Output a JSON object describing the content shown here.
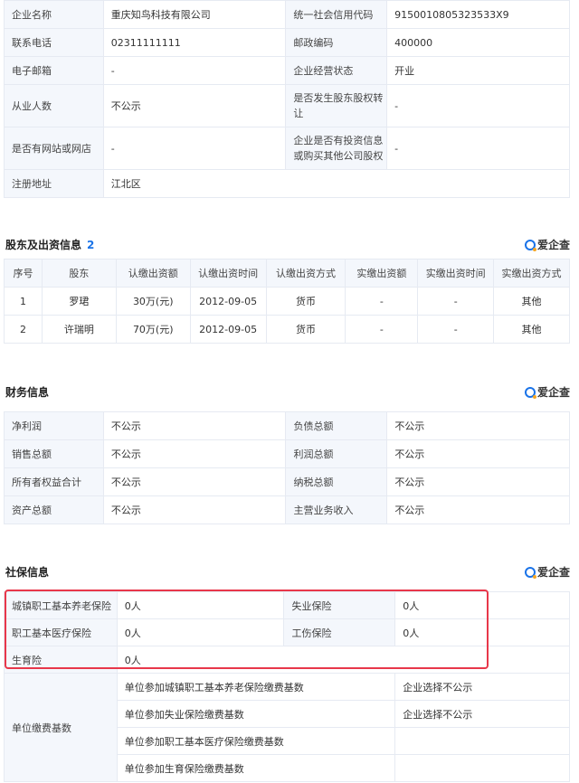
{
  "basic": {
    "rows": [
      {
        "l1": "企业名称",
        "v1": "重庆知鸟科技有限公司",
        "l2": "统一社会信用代码",
        "v2": "9150010805323533X9"
      },
      {
        "l1": "联系电话",
        "v1": "02311111111",
        "l2": "邮政编码",
        "v2": "400000"
      },
      {
        "l1": "电子邮箱",
        "v1": "-",
        "l2": "企业经营状态",
        "v2": "开业"
      },
      {
        "l1": "从业人数",
        "v1": "不公示",
        "l2": "是否发生股东股权转让",
        "v2": "-"
      },
      {
        "l1": "是否有网站或网店",
        "v1": "-",
        "l2": "企业是否有投资信息或购买其他公司股权",
        "v2": "-"
      }
    ],
    "address_label": "注册地址",
    "address_value": "江北区"
  },
  "shareholders": {
    "title": "股东及出资信息",
    "count": "2",
    "logo": "爱企查",
    "headers": [
      "序号",
      "股东",
      "认缴出资额",
      "认缴出资时间",
      "认缴出资方式",
      "实缴出资额",
      "实缴出资时间",
      "实缴出资方式"
    ],
    "rows": [
      [
        "1",
        "罗珺",
        "30万(元)",
        "2012-09-05",
        "货币",
        "-",
        "-",
        "其他"
      ],
      [
        "2",
        "许瑞明",
        "70万(元)",
        "2012-09-05",
        "货币",
        "-",
        "-",
        "其他"
      ]
    ]
  },
  "finance": {
    "title": "财务信息",
    "logo": "爱企查",
    "rows": [
      {
        "l1": "净利润",
        "v1": "不公示",
        "l2": "负债总额",
        "v2": "不公示"
      },
      {
        "l1": "销售总额",
        "v1": "不公示",
        "l2": "利润总额",
        "v2": "不公示"
      },
      {
        "l1": "所有者权益合计",
        "v1": "不公示",
        "l2": "纳税总额",
        "v2": "不公示"
      },
      {
        "l1": "资产总额",
        "v1": "不公示",
        "l2": "主营业务收入",
        "v2": "不公示"
      }
    ]
  },
  "social": {
    "title": "社保信息",
    "logo": "爱企查",
    "rows": [
      {
        "l1": "城镇职工基本养老保险",
        "v1": "0人",
        "l2": "失业保险",
        "v2": "0人"
      },
      {
        "l1": "职工基本医疗保险",
        "v1": "0人",
        "l2": "工伤保险",
        "v2": "0人"
      }
    ],
    "maternity_label": "生育险",
    "maternity_value": "0人",
    "base_label": "单位缴费基数",
    "base_rows": [
      {
        "item": "单位参加城镇职工基本养老保险缴费基数",
        "value": "企业选择不公示"
      },
      {
        "item": "单位参加失业保险缴费基数",
        "value": "企业选择不公示"
      },
      {
        "item": "单位参加职工基本医疗保险缴费基数",
        "value": ""
      },
      {
        "item": "单位参加生育保险缴费基数",
        "value": ""
      }
    ],
    "highlight_color": "#e8374a"
  }
}
